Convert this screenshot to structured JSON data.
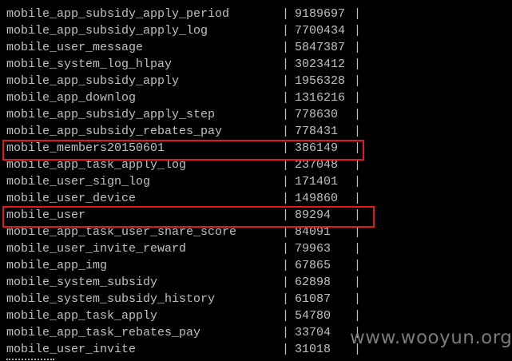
{
  "rows": [
    {
      "table": "mobile_app_subsidy_apply_period",
      "count": "9189697"
    },
    {
      "table": "mobile_app_subsidy_apply_log",
      "count": "7700434"
    },
    {
      "table": "mobile_user_message",
      "count": "5847387"
    },
    {
      "table": "mobile_system_log_hlpay",
      "count": "3023412"
    },
    {
      "table": "mobile_app_subsidy_apply",
      "count": "1956328"
    },
    {
      "table": "mobile_app_downlog",
      "count": "1316216"
    },
    {
      "table": "mobile_app_subsidy_apply_step",
      "count": "778630"
    },
    {
      "table": "mobile_app_subsidy_rebates_pay",
      "count": "778431"
    },
    {
      "table": "mobile_members20150601",
      "count": "386149"
    },
    {
      "table": "mobile_app_task_apply_log",
      "count": "237048"
    },
    {
      "table": "mobile_user_sign_log",
      "count": "171401"
    },
    {
      "table": "mobile_user_device",
      "count": "149860"
    },
    {
      "table": "mobile_user",
      "count": "89294"
    },
    {
      "table": "mobile_app_task_user_share_score",
      "count": "84091"
    },
    {
      "table": "mobile_user_invite_reward",
      "count": "79963"
    },
    {
      "table": "mobile_app_img",
      "count": "67865"
    },
    {
      "table": "mobile_system_subsidy",
      "count": "62898"
    },
    {
      "table": "mobile_system_subsidy_history",
      "count": "61087"
    },
    {
      "table": "mobile_app_task_apply",
      "count": "54780"
    },
    {
      "table": "mobile_app_task_rebates_pay",
      "count": "33704"
    },
    {
      "table": "mobile_user_invite",
      "count": "31018"
    }
  ],
  "separator": "|",
  "highlighted_rows": [
    "mobile_members20150601",
    "mobile_user"
  ],
  "highlight_color": "#e01a1a",
  "text_color": "#c0c0c0",
  "background_color": "#000000",
  "watermark": "www.wooyun.org"
}
